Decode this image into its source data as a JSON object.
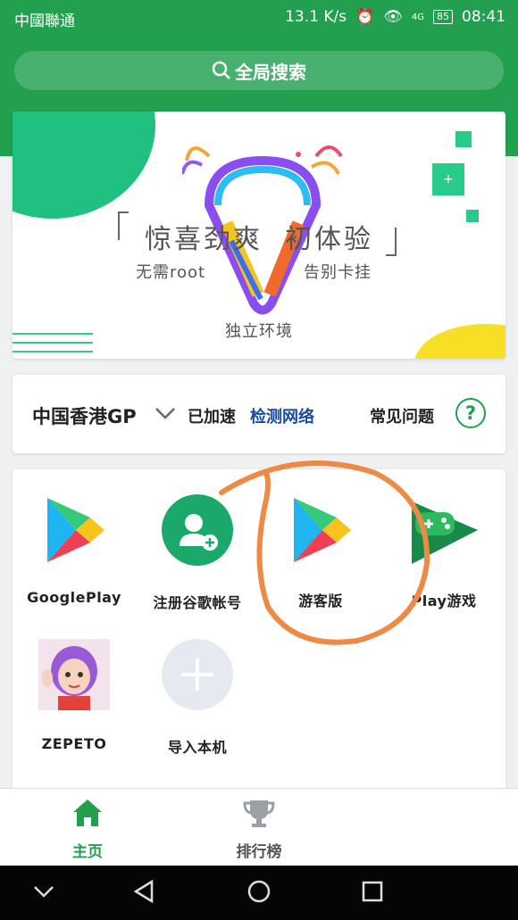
{
  "status_bar": {
    "carrier": "中國聯通",
    "speed": "13.1 K/s",
    "network": "4G",
    "battery": "85",
    "time": "08:41"
  },
  "search": {
    "label": "全局搜索"
  },
  "banner": {
    "title": "惊喜劲爽  初体验",
    "sub_left": "无需root",
    "sub_right": "告别卡挂",
    "sub_bottom": "独立环境",
    "plus": "+"
  },
  "server": {
    "name": "中国香港GP",
    "status": "已加速",
    "check": "检测网络",
    "faq": "常见问题",
    "help": "?"
  },
  "apps": [
    {
      "label": "GooglePlay",
      "icon": "google-play-icon"
    },
    {
      "label": "注册谷歌帐号",
      "icon": "add-account-icon"
    },
    {
      "label": "游客版",
      "icon": "google-play-icon"
    },
    {
      "label": "Play游戏",
      "icon": "play-games-icon"
    },
    {
      "label": "ZEPETO",
      "icon": "zepeto-avatar-icon"
    },
    {
      "label": "导入本机",
      "icon": "plus-icon"
    }
  ],
  "tabs": [
    {
      "label": "主页",
      "icon": "home-icon",
      "active": true
    },
    {
      "label": "排行榜",
      "icon": "trophy-icon",
      "active": false
    }
  ],
  "colors": {
    "primary": "#22a050",
    "accent_yellow": "#f6df24",
    "link": "#1a4aa0",
    "annotation": "#ee8a45"
  }
}
